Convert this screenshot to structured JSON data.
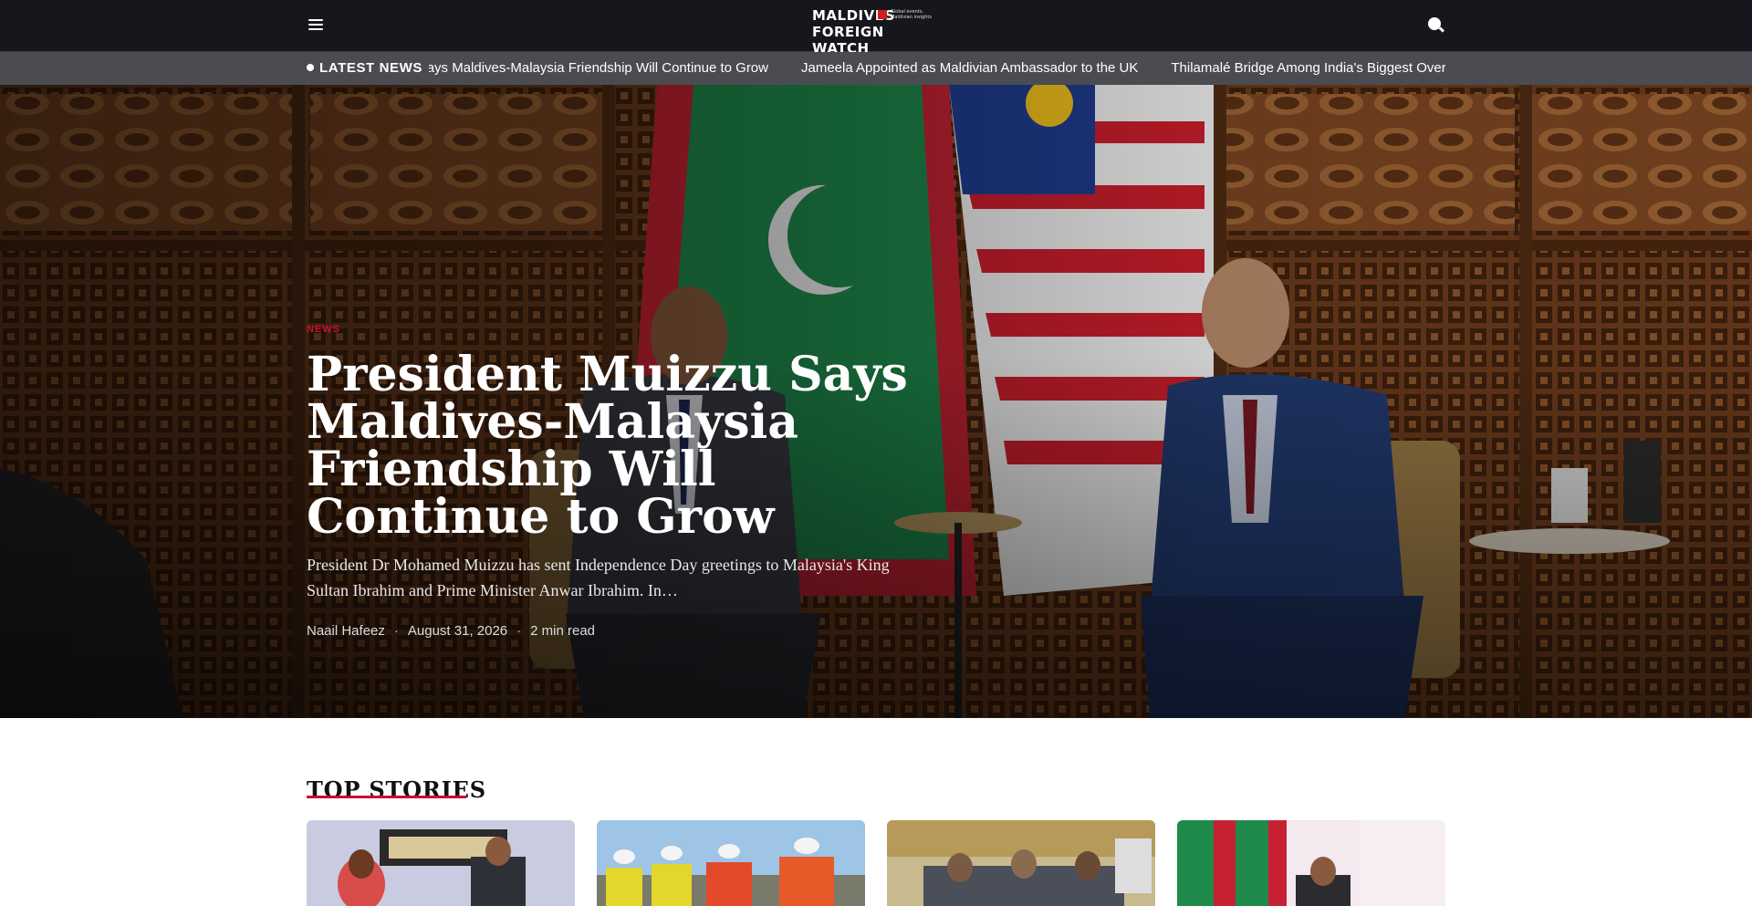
{
  "header": {
    "menu_icon": "hamburger-menu-icon",
    "logo_line1": "MALDIVES",
    "logo_tagline": "Global events, Maldivian insights",
    "logo_line2": "FOREIGN WATCH",
    "search_icon": "search-icon"
  },
  "ticker": {
    "label": "LATEST NEWS",
    "items": [
      "President Muizzu Says Maldives-Malaysia Friendship Will Continue to Grow",
      "Jameela Appointed as Maldivian Ambassador to the UK",
      "Thilamalé Bridge Among India's Biggest Overseas Projects"
    ]
  },
  "hero": {
    "category": "NEWS",
    "title": "President Muizzu Says Maldives-Malaysia Friendship Will Continue to Grow",
    "excerpt": "President Dr Mohamed Muizzu has sent Independence Day greetings to Malaysia's King Sultan Ibrahim and Prime Minister Anwar Ibrahim. In…",
    "author": "Naail Hafeez",
    "date": "August 31, 2026",
    "read_time": "2 min read"
  },
  "top_stories": {
    "title": "TOP STORIES",
    "accent_color": "#c8102e"
  }
}
